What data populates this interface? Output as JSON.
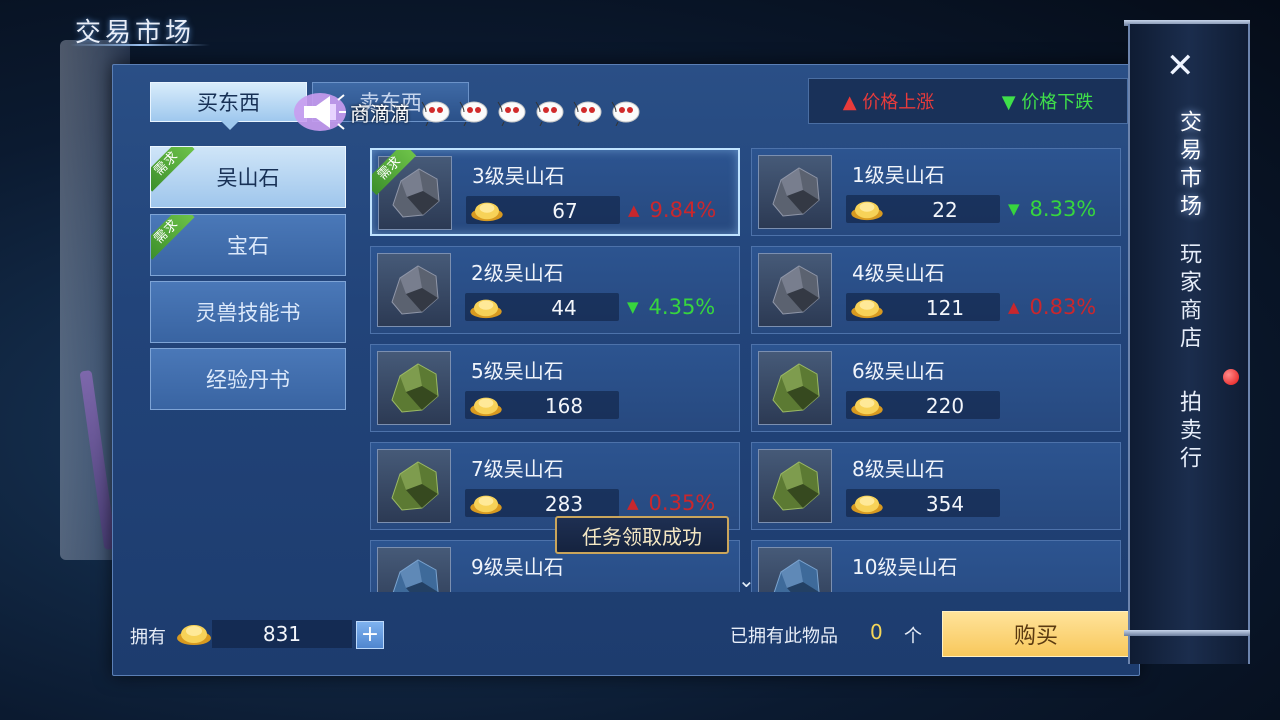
{
  "title": "交易市场",
  "tabs": {
    "buy": "买东西",
    "sell": "卖东西"
  },
  "broadcast": {
    "text": "商滴滴",
    "emoji_count": 6
  },
  "legend": {
    "up_label": "价格上涨",
    "down_label": "价格下跌"
  },
  "categories": [
    {
      "label": "吴山石",
      "need_tag": "需求",
      "active": true
    },
    {
      "label": "宝石",
      "need_tag": "需求",
      "active": false
    },
    {
      "label": "灵兽技能书",
      "need_tag": "",
      "active": false
    },
    {
      "label": "经验丹书",
      "need_tag": "",
      "active": false
    }
  ],
  "items": [
    {
      "name": "3级吴山石",
      "price": "67",
      "trend": "up",
      "change": "9.84%",
      "need_tag": "需求",
      "color": "gray"
    },
    {
      "name": "1级吴山石",
      "price": "22",
      "trend": "down",
      "change": "8.33%",
      "need_tag": "",
      "color": "gray"
    },
    {
      "name": "2级吴山石",
      "price": "44",
      "trend": "down",
      "change": "4.35%",
      "need_tag": "",
      "color": "gray"
    },
    {
      "name": "4级吴山石",
      "price": "121",
      "trend": "up",
      "change": "0.83%",
      "need_tag": "",
      "color": "gray"
    },
    {
      "name": "5级吴山石",
      "price": "168",
      "trend": "",
      "change": "",
      "need_tag": "",
      "color": "green"
    },
    {
      "name": "6级吴山石",
      "price": "220",
      "trend": "",
      "change": "",
      "need_tag": "",
      "color": "green"
    },
    {
      "name": "7级吴山石",
      "price": "283",
      "trend": "up",
      "change": "0.35%",
      "need_tag": "",
      "color": "green"
    },
    {
      "name": "8级吴山石",
      "price": "354",
      "trend": "",
      "change": "",
      "need_tag": "",
      "color": "green"
    },
    {
      "name": "9级吴山石",
      "price": "",
      "trend": "",
      "change": "",
      "need_tag": "",
      "color": "blue"
    },
    {
      "name": "10级吴山石",
      "price": "",
      "trend": "",
      "change": "",
      "need_tag": "",
      "color": "blue"
    }
  ],
  "toast": "任务领取成功",
  "footer": {
    "own_label": "拥有",
    "balance": "831",
    "plus": "+",
    "owned_label": "已拥有此物品",
    "owned_count": "0",
    "owned_unit": "个",
    "buy_label": "购买"
  },
  "side_nav": {
    "close": "✕",
    "items": [
      "交易市场",
      "玩家商店",
      "拍卖行"
    ]
  },
  "colors": {
    "up": "#c9272d",
    "down": "#37d53e",
    "buy_button": "#f8c85c",
    "panel": "#22447a"
  }
}
